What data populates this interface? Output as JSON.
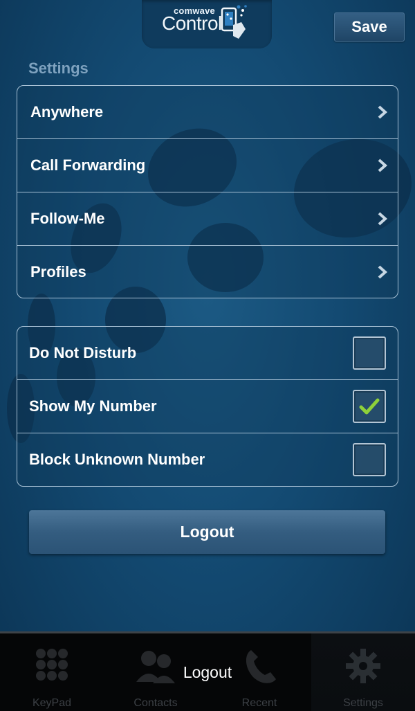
{
  "header": {
    "logo_small": "comwave",
    "logo_big": "Control",
    "save_label": "Save"
  },
  "settings": {
    "section_title": "Settings",
    "nav_items": [
      {
        "label": "Anywhere"
      },
      {
        "label": "Call Forwarding"
      },
      {
        "label": "Follow-Me"
      },
      {
        "label": "Profiles"
      }
    ],
    "toggles": [
      {
        "label": "Do Not Disturb",
        "checked": false
      },
      {
        "label": "Show My Number",
        "checked": true
      },
      {
        "label": "Block Unknown Number",
        "checked": false
      }
    ]
  },
  "logout_button": {
    "label": "Logout"
  },
  "toast": {
    "text": "Logout"
  },
  "tabbar": {
    "tabs": [
      {
        "label": "KeyPad",
        "icon": "keypad-icon"
      },
      {
        "label": "Contacts",
        "icon": "contacts-icon"
      },
      {
        "label": "Recent",
        "icon": "recent-icon"
      },
      {
        "label": "Settings",
        "icon": "gear-icon",
        "active": true
      }
    ]
  },
  "colors": {
    "background": "#134a72",
    "checkmark": "#8ed13a",
    "border": "#a9c2d6"
  }
}
